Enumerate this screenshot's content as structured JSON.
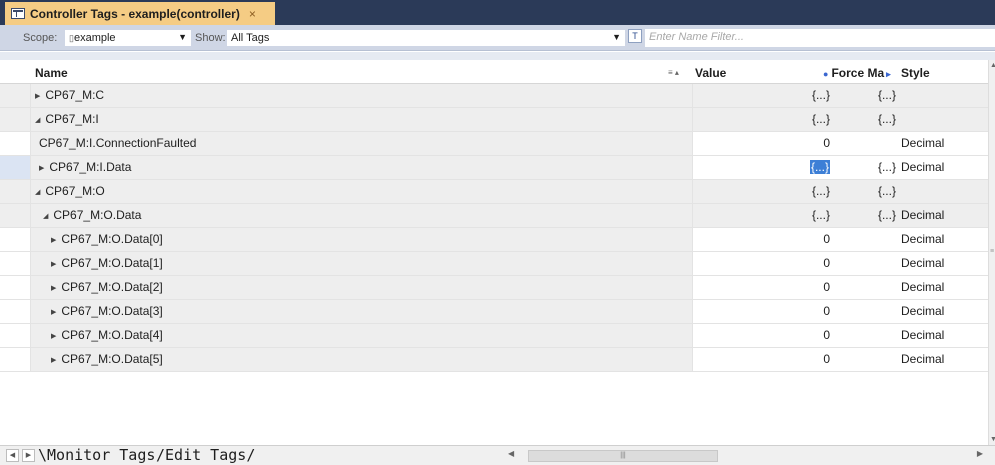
{
  "window": {
    "tab_title": "Controller Tags - example(controller)",
    "tab_close": "×"
  },
  "toolbar": {
    "scope_label": "Scope:",
    "scope_value": "example",
    "show_label": "Show:",
    "show_value": "All Tags",
    "filter_placeholder": "Enter Name Filter..."
  },
  "columns": {
    "name": "Name",
    "value": "Value",
    "force_mask": "Force Ma",
    "style": "Style"
  },
  "rows": [
    {
      "name": "CP67_M:C",
      "value": "{...}",
      "force": "{...}",
      "style": ""
    },
    {
      "name": "CP67_M:I",
      "value": "{...}",
      "force": "{...}",
      "style": ""
    },
    {
      "name": "CP67_M:I.ConnectionFaulted",
      "value": "0",
      "force": "",
      "style": "Decimal"
    },
    {
      "name": "CP67_M:I.Data",
      "value": "{...}",
      "force": "{...}",
      "style": "Decimal"
    },
    {
      "name": "CP67_M:O",
      "value": "{...}",
      "force": "{...}",
      "style": ""
    },
    {
      "name": "CP67_M:O.Data",
      "value": "{...}",
      "force": "{...}",
      "style": "Decimal"
    },
    {
      "name": "CP67_M:O.Data[0]",
      "value": "0",
      "force": "",
      "style": "Decimal"
    },
    {
      "name": "CP67_M:O.Data[1]",
      "value": "0",
      "force": "",
      "style": "Decimal"
    },
    {
      "name": "CP67_M:O.Data[2]",
      "value": "0",
      "force": "",
      "style": "Decimal"
    },
    {
      "name": "CP67_M:O.Data[3]",
      "value": "0",
      "force": "",
      "style": "Decimal"
    },
    {
      "name": "CP67_M:O.Data[4]",
      "value": "0",
      "force": "",
      "style": "Decimal"
    },
    {
      "name": "CP67_M:O.Data[5]",
      "value": "0",
      "force": "",
      "style": "Decimal"
    }
  ],
  "sheet_tabs": {
    "monitor": "Monitor Tags",
    "edit": "Edit Tags"
  },
  "colors": {
    "title_bar": "#2b3a58",
    "active_tab": "#f5cc84",
    "toolbar": "#cfd6e5",
    "selected_value": "#3d7fd6"
  }
}
